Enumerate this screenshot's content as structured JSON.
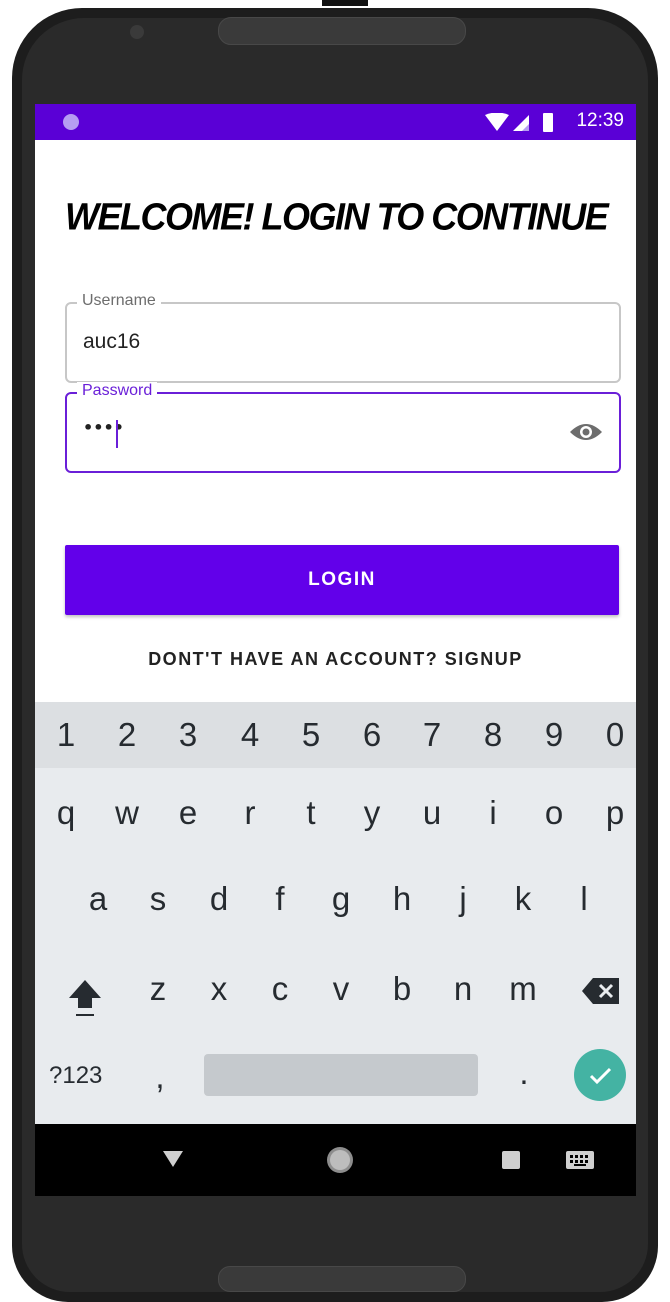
{
  "status_bar": {
    "time": "12:39"
  },
  "screen": {
    "title": "WELCOME! LOGIN TO CONTINUE",
    "username": {
      "label": "Username",
      "value": "auc16"
    },
    "password": {
      "label": "Password",
      "masked_value": "••••"
    },
    "login_button": "LOGIN",
    "signup_link": "DONT'T HAVE AN ACCOUNT? SIGNUP"
  },
  "keyboard": {
    "number_row": [
      "1",
      "2",
      "3",
      "4",
      "5",
      "6",
      "7",
      "8",
      "9",
      "0"
    ],
    "row1": [
      "q",
      "w",
      "e",
      "r",
      "t",
      "y",
      "u",
      "i",
      "o",
      "p"
    ],
    "row2": [
      "a",
      "s",
      "d",
      "f",
      "g",
      "h",
      "j",
      "k",
      "l"
    ],
    "row3": [
      "z",
      "x",
      "c",
      "v",
      "b",
      "n",
      "m"
    ],
    "symbols_key": "?123",
    "comma_key": ",",
    "period_key": "."
  },
  "colors": {
    "primary": "#6200ea",
    "status_bar": "#5a00d6",
    "accent_check": "#44b3a3"
  },
  "icons": [
    "wifi-icon",
    "signal-icon",
    "battery-icon",
    "eye-icon",
    "shift-icon",
    "backspace-icon",
    "check-icon",
    "back-icon",
    "home-icon",
    "recents-icon",
    "keyboard-icon"
  ]
}
